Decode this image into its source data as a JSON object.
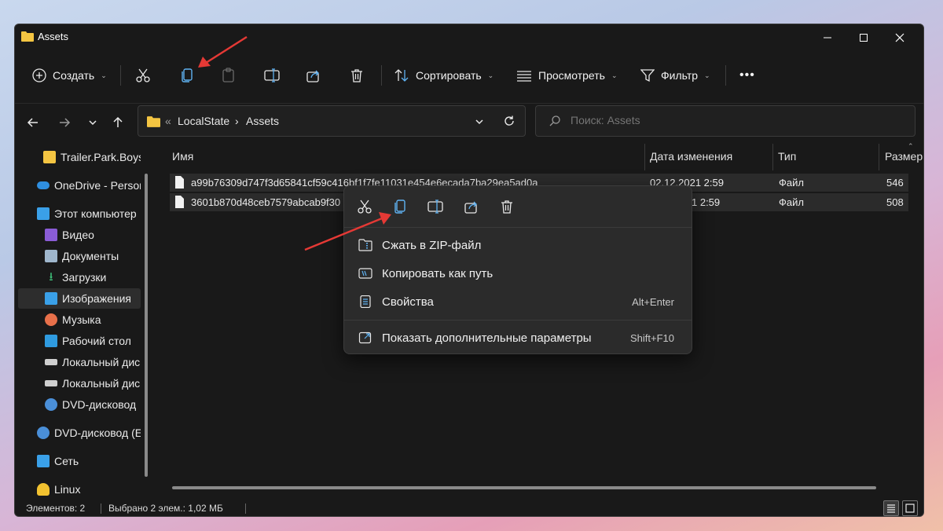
{
  "window": {
    "title": "Assets"
  },
  "toolbar": {
    "new_label": "Создать",
    "sort_label": "Сортировать",
    "view_label": "Просмотреть",
    "filter_label": "Фильтр",
    "more_label": "•••"
  },
  "address": {
    "overflow": "«",
    "crumbs": [
      "LocalState",
      "Assets"
    ]
  },
  "search": {
    "placeholder": "Поиск: Assets"
  },
  "sidebar": {
    "items": [
      {
        "label": "Trailer.Park.Boys",
        "icon": "folder-icon"
      },
      {
        "label": "OneDrive - Persor",
        "icon": "onedrive-icon"
      },
      {
        "label": "Этот компьютер",
        "icon": "computer-icon"
      },
      {
        "label": "Видео",
        "icon": "video-icon"
      },
      {
        "label": "Документы",
        "icon": "documents-icon"
      },
      {
        "label": "Загрузки",
        "icon": "downloads-icon"
      },
      {
        "label": "Изображения",
        "icon": "pictures-icon"
      },
      {
        "label": "Музыка",
        "icon": "music-icon"
      },
      {
        "label": "Рабочий стол",
        "icon": "desktop-icon"
      },
      {
        "label": "Локальный дис",
        "icon": "drive-icon"
      },
      {
        "label": "Локальный дис",
        "icon": "drive-icon"
      },
      {
        "label": "DVD-дисковод",
        "icon": "dvd-icon"
      },
      {
        "label": "DVD-дисковод (E",
        "icon": "dvd-icon"
      },
      {
        "label": "Сеть",
        "icon": "network-icon"
      },
      {
        "label": "Linux",
        "icon": "linux-icon"
      }
    ]
  },
  "files": {
    "columns": [
      "Имя",
      "Дата изменения",
      "Тип",
      "Размер"
    ],
    "rows": [
      {
        "name": "a99b76309d747f3d65841cf59c416bf1f7fe11031e454e6ecada7ba29ea5ad0a",
        "date": "02.12.2021 2:59",
        "type": "Файл",
        "size": "546"
      },
      {
        "name": "3601b870d48ceb7579abcab9f30",
        "date": "1 2:59",
        "type": "Файл",
        "size": "508"
      }
    ]
  },
  "status": {
    "count": "Элементов: 2",
    "selected": "Выбрано 2 элем.: 1,02 МБ"
  },
  "context_menu": {
    "items": [
      {
        "label": "Сжать в ZIP-файл",
        "shortcut": ""
      },
      {
        "label": "Копировать как путь",
        "shortcut": ""
      },
      {
        "label": "Свойства",
        "shortcut": "Alt+Enter"
      },
      {
        "label": "Показать дополнительные параметры",
        "shortcut": "Shift+F10"
      }
    ]
  },
  "colors": {
    "accent": "#e53935",
    "folder": "#f4c542",
    "window_bg": "#191919",
    "menu_bg": "#2b2b2b"
  }
}
